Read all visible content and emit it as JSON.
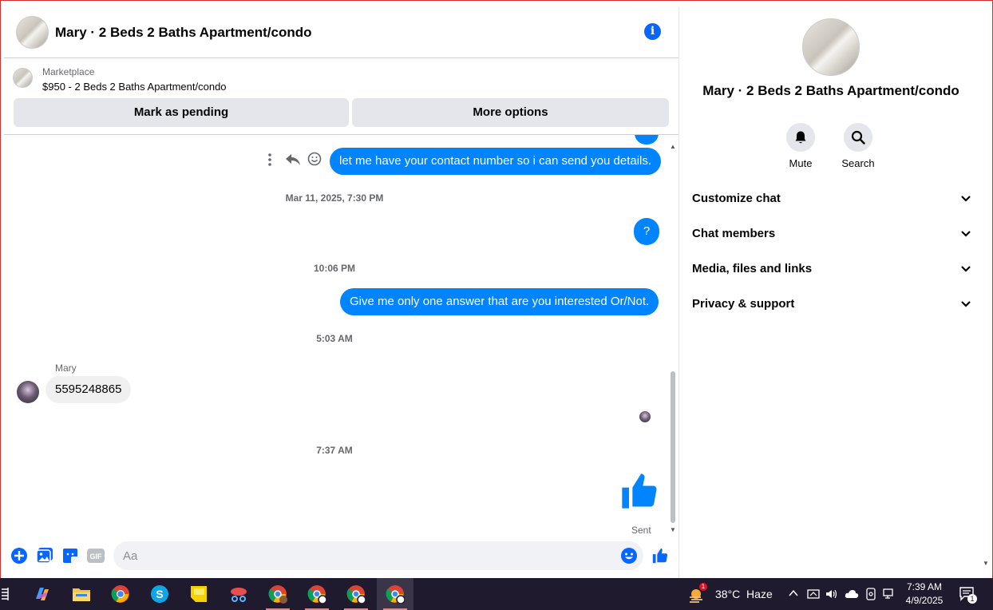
{
  "header": {
    "title": "Mary · 2 Beds 2 Baths Apartment/condo",
    "info_icon": "info-icon"
  },
  "listing": {
    "source": "Marketplace",
    "price_title": "$950 - 2 Beds 2 Baths Apartment/condo",
    "pending_label": "Mark as pending",
    "more_label": "More options"
  },
  "thread": {
    "msg1": "let me have your contact number so i can send you details.",
    "ts1": "Mar 11, 2025, 7:30 PM",
    "msg2": "?",
    "ts2": "10:06 PM",
    "msg3": "Give me only one answer that are you interested Or/Not.",
    "ts3": "5:03 AM",
    "sender": "Mary",
    "msg4": "5595248865",
    "ts4": "7:37 AM",
    "status": "Sent"
  },
  "composer": {
    "placeholder": "Aa"
  },
  "sidebar": {
    "title": "Mary · 2 Beds 2 Baths Apartment/condo",
    "mute": "Mute",
    "search": "Search",
    "sections": [
      "Customize chat",
      "Chat members",
      "Media, files and links",
      "Privacy & support"
    ]
  },
  "taskbar": {
    "weather": "38°C  Haze",
    "weather_badge": "1",
    "time": "7:39 AM",
    "date": "4/9/2025",
    "notif_count": "1"
  },
  "colors": {
    "accent": "#0866ff",
    "bubble": "#0084ff",
    "taskbar": "#1f1a2e"
  }
}
